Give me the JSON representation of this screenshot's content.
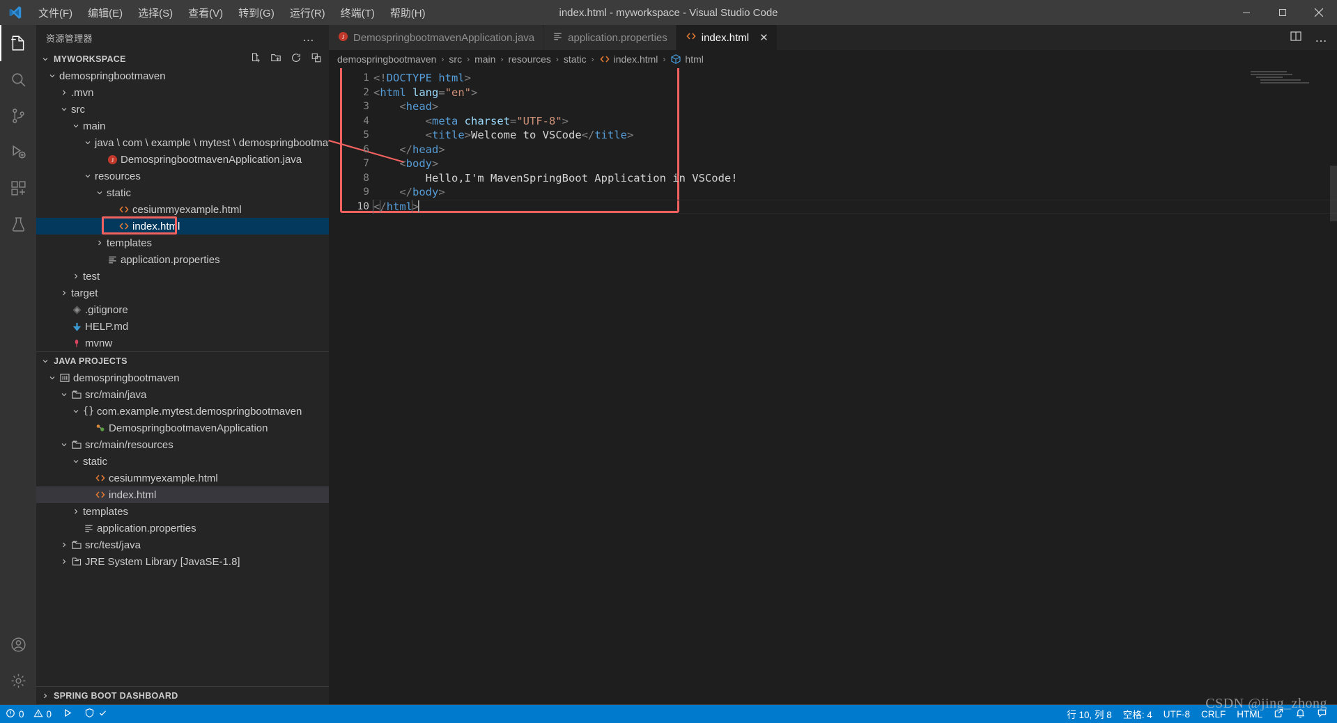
{
  "window": {
    "title": "index.html - myworkspace - Visual Studio Code",
    "logo_icon": "vscode-logo-icon",
    "minimize_icon": "minimize-icon",
    "maximize_icon": "maximize-icon",
    "close_icon": "close-icon"
  },
  "menubar": {
    "items": [
      {
        "label": "文件(F)",
        "name": "menu-file"
      },
      {
        "label": "编辑(E)",
        "name": "menu-edit"
      },
      {
        "label": "选择(S)",
        "name": "menu-selection"
      },
      {
        "label": "查看(V)",
        "name": "menu-view"
      },
      {
        "label": "转到(G)",
        "name": "menu-go"
      },
      {
        "label": "运行(R)",
        "name": "menu-run"
      },
      {
        "label": "终端(T)",
        "name": "menu-terminal"
      },
      {
        "label": "帮助(H)",
        "name": "menu-help"
      }
    ]
  },
  "activitybar": {
    "items": [
      {
        "icon": "explorer-files-icon",
        "active": true
      },
      {
        "icon": "search-icon",
        "active": false
      },
      {
        "icon": "source-control-branch-icon",
        "active": false
      },
      {
        "icon": "run-and-debug-icon",
        "active": false
      },
      {
        "icon": "extensions-icon",
        "active": false
      },
      {
        "icon": "testing-beaker-icon",
        "active": false
      }
    ],
    "bottom": [
      {
        "icon": "account-icon"
      },
      {
        "icon": "settings-gear-icon"
      }
    ]
  },
  "sidebar": {
    "title": "资源管理器",
    "more_actions": "…",
    "explorer": {
      "header": "MYWORKSPACE",
      "actions": [
        "new-file-icon",
        "new-folder-icon",
        "refresh-icon",
        "collapse-all-icon"
      ],
      "tree": [
        {
          "label": "demospringbootmaven",
          "depth": 1,
          "twisty": "expanded",
          "icon": "",
          "kind": "folder"
        },
        {
          "label": ".mvn",
          "depth": 2,
          "twisty": "collapsed",
          "icon": "",
          "kind": "folder"
        },
        {
          "label": "src",
          "depth": 2,
          "twisty": "expanded",
          "icon": "",
          "kind": "folder"
        },
        {
          "label": "main",
          "depth": 3,
          "twisty": "expanded",
          "icon": "",
          "kind": "folder"
        },
        {
          "label": "java \\ com \\ example \\ mytest \\ demospringbootmaven",
          "depth": 4,
          "twisty": "expanded",
          "icon": "",
          "kind": "folder"
        },
        {
          "label": "DemospringbootmavenApplication.java",
          "depth": 5,
          "twisty": "none",
          "icon": "java-icon",
          "kind": "file"
        },
        {
          "label": "resources",
          "depth": 4,
          "twisty": "expanded",
          "icon": "",
          "kind": "folder"
        },
        {
          "label": "static",
          "depth": 5,
          "twisty": "expanded",
          "icon": "",
          "kind": "folder"
        },
        {
          "label": "cesiummyexample.html",
          "depth": 6,
          "twisty": "none",
          "icon": "html-icon",
          "kind": "file"
        },
        {
          "label": "index.html",
          "depth": 6,
          "twisty": "none",
          "icon": "html-icon",
          "kind": "file",
          "selected": true,
          "highlight_box": true
        },
        {
          "label": "templates",
          "depth": 5,
          "twisty": "collapsed",
          "icon": "",
          "kind": "folder"
        },
        {
          "label": "application.properties",
          "depth": 5,
          "twisty": "none",
          "icon": "properties-icon",
          "kind": "file"
        },
        {
          "label": "test",
          "depth": 3,
          "twisty": "collapsed",
          "icon": "",
          "kind": "folder"
        },
        {
          "label": "target",
          "depth": 2,
          "twisty": "collapsed",
          "icon": "",
          "kind": "folder"
        },
        {
          "label": ".gitignore",
          "depth": 2,
          "twisty": "none",
          "icon": "git-icon",
          "kind": "file"
        },
        {
          "label": "HELP.md",
          "depth": 2,
          "twisty": "none",
          "icon": "markdown-icon",
          "kind": "file"
        },
        {
          "label": "mvnw",
          "depth": 2,
          "twisty": "none",
          "icon": "maven-wrapper-icon",
          "kind": "file"
        }
      ]
    },
    "java_projects": {
      "header": "JAVA PROJECTS",
      "tree": [
        {
          "label": "demospringbootmaven",
          "depth": 1,
          "twisty": "expanded",
          "icon": "java-project-icon"
        },
        {
          "label": "src/main/java",
          "depth": 2,
          "twisty": "expanded",
          "icon": "source-folder-icon"
        },
        {
          "label": "com.example.mytest.demospringbootmaven",
          "depth": 3,
          "twisty": "expanded",
          "icon": "package-braces-icon"
        },
        {
          "label": "DemospringbootmavenApplication",
          "depth": 4,
          "twisty": "none",
          "icon": "java-class-icon"
        },
        {
          "label": "src/main/resources",
          "depth": 2,
          "twisty": "expanded",
          "icon": "source-folder-icon"
        },
        {
          "label": "static",
          "depth": 3,
          "twisty": "expanded",
          "icon": ""
        },
        {
          "label": "cesiummyexample.html",
          "depth": 4,
          "twisty": "none",
          "icon": "html-icon"
        },
        {
          "label": "index.html",
          "depth": 4,
          "twisty": "none",
          "icon": "html-icon",
          "selected_grey": true
        },
        {
          "label": "templates",
          "depth": 3,
          "twisty": "collapsed",
          "icon": ""
        },
        {
          "label": "application.properties",
          "depth": 3,
          "twisty": "none",
          "icon": "properties-icon"
        },
        {
          "label": "src/test/java",
          "depth": 2,
          "twisty": "collapsed",
          "icon": "source-folder-icon"
        },
        {
          "label": "JRE System Library [JavaSE-1.8]",
          "depth": 2,
          "twisty": "collapsed",
          "icon": "library-icon"
        }
      ]
    },
    "spring_boot_dashboard": {
      "header": "SPRING BOOT DASHBOARD"
    }
  },
  "editor": {
    "tabs": [
      {
        "label": "DemospringbootmavenApplication.java",
        "icon": "java-icon",
        "active": false,
        "closable": false
      },
      {
        "label": "application.properties",
        "icon": "properties-icon",
        "active": false,
        "closable": false
      },
      {
        "label": "index.html",
        "icon": "html-icon",
        "active": true,
        "closable": true,
        "close_label": "✕"
      }
    ],
    "tab_actions": [
      "split-editor-icon",
      "more-actions-icon"
    ],
    "breadcrumb": [
      {
        "label": "demospringbootmaven",
        "icon": ""
      },
      {
        "label": "src",
        "icon": ""
      },
      {
        "label": "main",
        "icon": ""
      },
      {
        "label": "resources",
        "icon": ""
      },
      {
        "label": "static",
        "icon": ""
      },
      {
        "label": "index.html",
        "icon": "html-icon"
      },
      {
        "label": "html",
        "icon": "html-symbol-icon"
      }
    ],
    "breadcrumb_separator": "›",
    "line_numbers": [
      "1",
      "2",
      "3",
      "4",
      "5",
      "6",
      "7",
      "8",
      "9",
      "10"
    ],
    "code_lines": [
      "<!DOCTYPE html>",
      "<html lang=\"en\">",
      "    <head>",
      "        <meta charset=\"UTF-8\">",
      "        <title>Welcome to VSCode</title>",
      "    </head>",
      "    <body>",
      "        Hello,I'm MavenSpringBoot Application in VSCode!",
      "    </body>",
      "</html>"
    ],
    "current_line": 10,
    "annotation": {
      "highlight_color": "#f0615f",
      "kind": "red-rectangle-and-arrow"
    }
  },
  "statusbar": {
    "left": [
      {
        "label": "0",
        "icon": "error-icon",
        "name": "status-errors"
      },
      {
        "label": "0",
        "icon": "warning-icon",
        "name": "status-warnings"
      },
      {
        "label": "",
        "icon": "spring-boot-run-icon",
        "name": "status-spring-run"
      },
      {
        "label": "",
        "icon": "shield-check-icon",
        "name": "status-shield"
      }
    ],
    "right": [
      {
        "label": "行 10, 列 8",
        "name": "status-cursor-position"
      },
      {
        "label": "空格: 4",
        "name": "status-indentation"
      },
      {
        "label": "UTF-8",
        "name": "status-encoding"
      },
      {
        "label": "CRLF",
        "name": "status-eol"
      },
      {
        "label": "HTML",
        "name": "status-language-mode"
      },
      {
        "label": "",
        "icon": "open-browser-icon",
        "name": "status-open-in-browser"
      },
      {
        "label": "",
        "icon": "bell-icon",
        "name": "status-notifications"
      },
      {
        "label": "",
        "icon": "feedback-icon",
        "name": "status-feedback"
      }
    ],
    "background_color": "#007acc"
  },
  "watermark": "CSDN @jing_zhong"
}
